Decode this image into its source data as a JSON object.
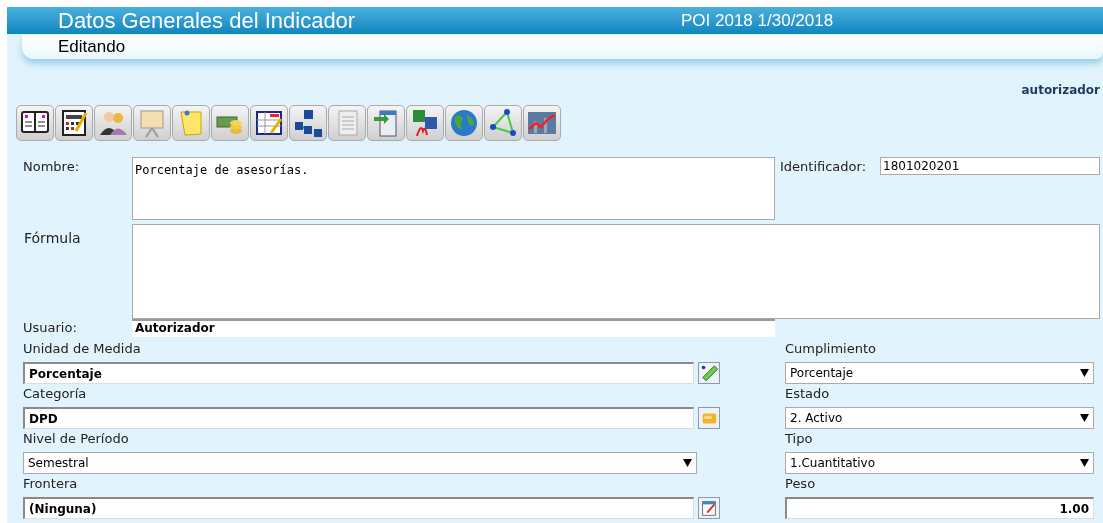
{
  "header": {
    "title": "Datos Generales del Indicador",
    "subtitle": "POI 2018 1/30/2018"
  },
  "mode": "Editando",
  "current_user": "autorizador",
  "nombre": {
    "label": "Nombre:",
    "value": "Porcentaje de asesorías."
  },
  "identificador": {
    "label": "Identificador:",
    "value": "1801020201"
  },
  "formula": {
    "label": "Fórmula"
  },
  "usuario": {
    "label": "Usuario:",
    "value": "Autorizador"
  },
  "left_fields": [
    {
      "kind": "lookup",
      "label": "Unidad de Medida",
      "value": "Porcentaje"
    },
    {
      "kind": "lookup",
      "label": "Categoría",
      "value": "DPD"
    },
    {
      "kind": "select",
      "label": "Nivel de Período",
      "value": "Semestral"
    },
    {
      "kind": "lookup",
      "label": "Frontera",
      "value": "(Ninguna)"
    }
  ],
  "right_fields": [
    {
      "kind": "select",
      "label": "Cumplimiento",
      "value": "Porcentaje"
    },
    {
      "kind": "select",
      "label": "Estado",
      "value": "2. Activo"
    },
    {
      "kind": "select",
      "label": "Tipo",
      "value": "1.Cuantitativo"
    },
    {
      "kind": "number",
      "label": "Peso",
      "value": "1.00"
    }
  ]
}
